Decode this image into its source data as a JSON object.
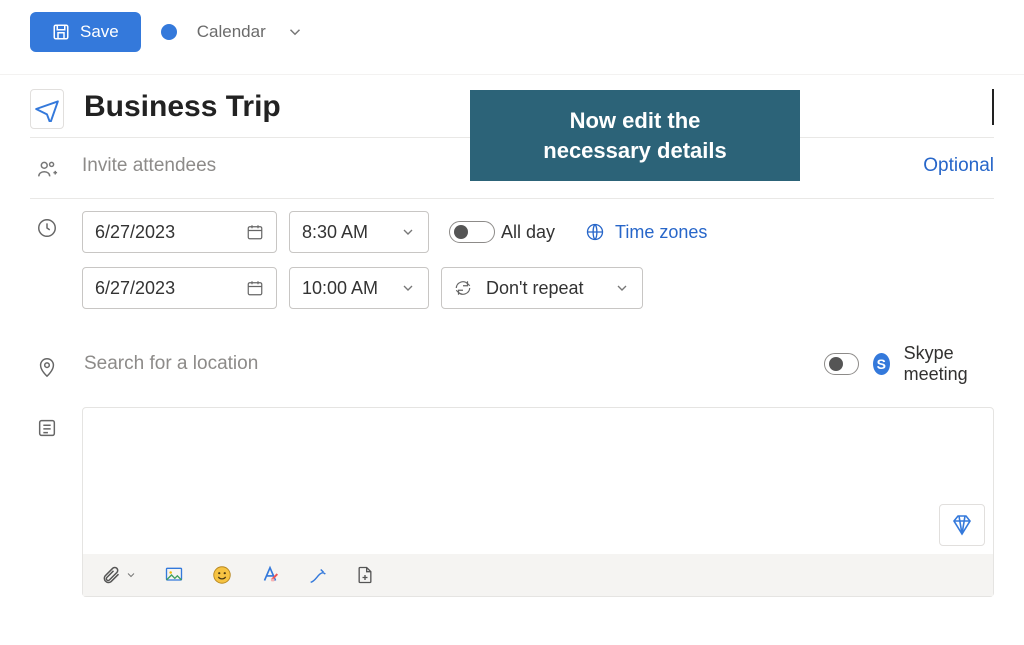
{
  "toolbar": {
    "save_label": "Save",
    "calendar_label": "Calendar"
  },
  "event": {
    "icon": "airplane-icon",
    "title": "Business Trip"
  },
  "attendees": {
    "placeholder": "Invite attendees",
    "optional_label": "Optional"
  },
  "datetime": {
    "start_date": "6/27/2023",
    "start_time": "8:30 AM",
    "end_date": "6/27/2023",
    "end_time": "10:00 AM",
    "all_day_label": "All day",
    "all_day_on": false,
    "timezones_label": "Time zones",
    "repeat_label": "Don't repeat"
  },
  "location": {
    "placeholder": "Search for a location",
    "skype_on": false,
    "skype_label": "Skype meeting"
  },
  "callout": {
    "line1": "Now edit the",
    "line2": "necessary details"
  },
  "body_toolbar": {
    "attach": "attachment-icon",
    "image": "picture-icon",
    "emoji": "emoji-icon",
    "font": "font-clear-icon",
    "ink": "ink-icon",
    "insert": "insert-page-icon"
  },
  "colors": {
    "primary": "#3479db",
    "callout_bg": "#2c6378"
  }
}
